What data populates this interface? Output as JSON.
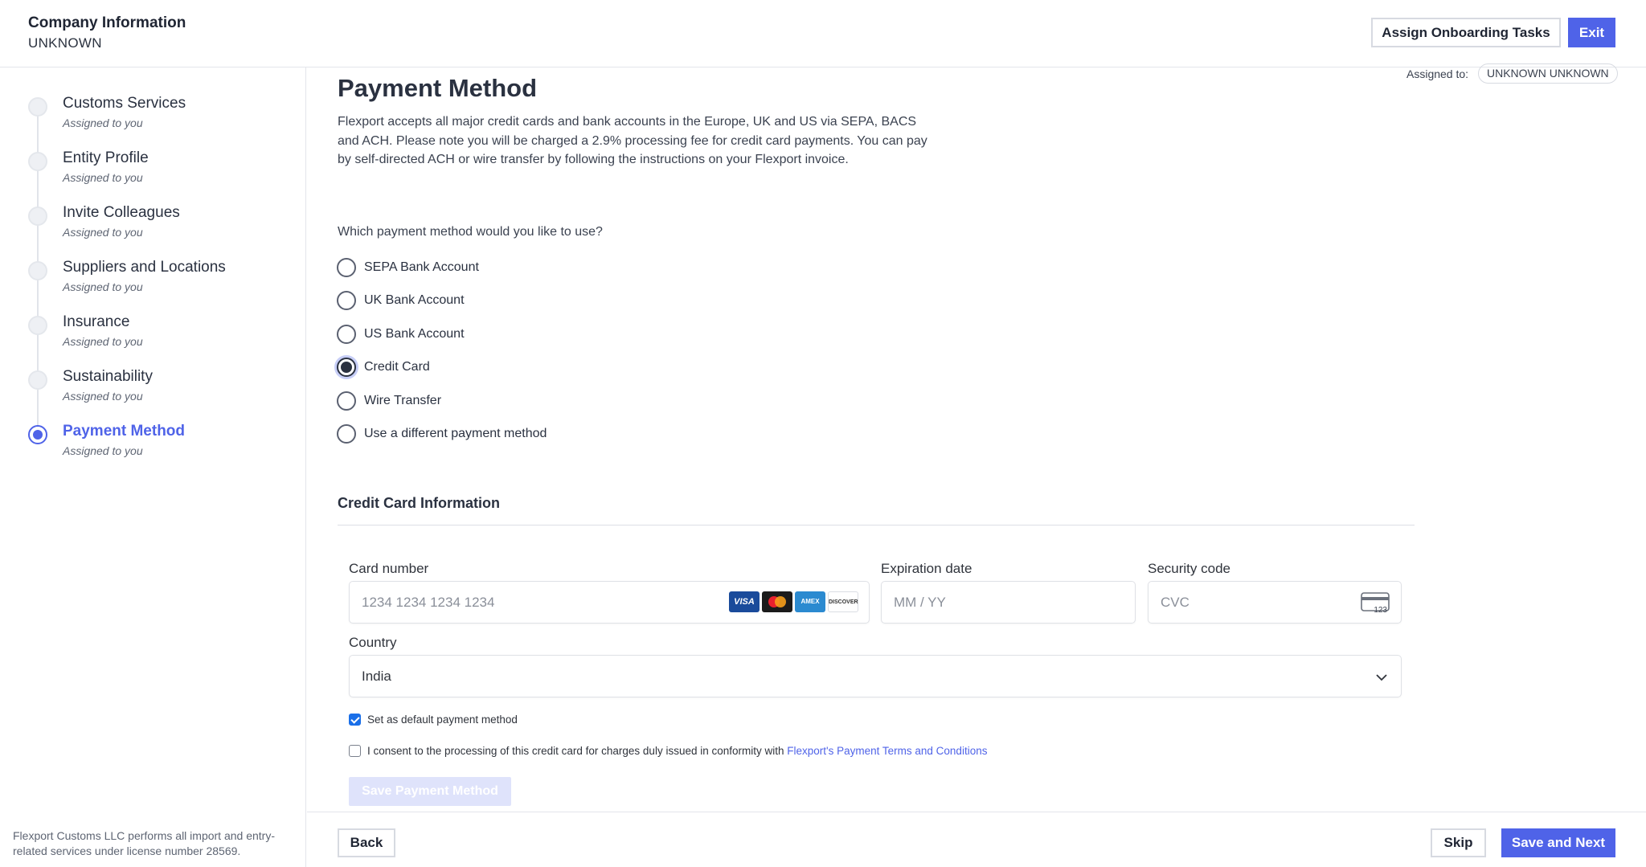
{
  "header": {
    "title": "Company Information",
    "company": "UNKNOWN",
    "assign_button": "Assign Onboarding Tasks",
    "exit_button": "Exit"
  },
  "sidebar": {
    "steps": [
      {
        "title": "Customs Services",
        "sub": "Assigned to you",
        "active": false
      },
      {
        "title": "Entity Profile",
        "sub": "Assigned to you",
        "active": false
      },
      {
        "title": "Invite Colleagues",
        "sub": "Assigned to you",
        "active": false
      },
      {
        "title": "Suppliers and Locations",
        "sub": "Assigned to you",
        "active": false
      },
      {
        "title": "Insurance",
        "sub": "Assigned to you",
        "active": false
      },
      {
        "title": "Sustainability",
        "sub": "Assigned to you",
        "active": false
      },
      {
        "title": "Payment Method",
        "sub": "Assigned to you",
        "active": true
      }
    ],
    "footer": "Flexport Customs LLC performs all import and entry-related services under license number 28569."
  },
  "main": {
    "assigned_label": "Assigned to:",
    "assigned_to": "UNKNOWN UNKNOWN",
    "title": "Payment Method",
    "intro": "Flexport accepts all major credit cards and bank accounts in the Europe, UK and US via SEPA, BACS and ACH. Please note you will be charged a 2.9% processing fee for credit card payments. You can pay by self-directed ACH or wire transfer by following the instructions on your Flexport invoice.",
    "question": "Which payment method would you like to use?",
    "options": [
      {
        "label": "SEPA Bank Account",
        "checked": false
      },
      {
        "label": "UK Bank Account",
        "checked": false
      },
      {
        "label": "US Bank Account",
        "checked": false
      },
      {
        "label": "Credit Card",
        "checked": true
      },
      {
        "label": "Wire Transfer",
        "checked": false
      },
      {
        "label": "Use a different payment method",
        "checked": false
      }
    ]
  },
  "credit_card": {
    "heading": "Credit Card Information",
    "card_number_label": "Card number",
    "card_number_placeholder": "1234 1234 1234 1234",
    "brands": [
      "VISA",
      "MC",
      "AMEX",
      "DISCOVER"
    ],
    "expiration_label": "Expiration date",
    "expiration_placeholder": "MM / YY",
    "security_label": "Security code",
    "security_placeholder": "CVC",
    "cvc_icon_text": "123",
    "country_label": "Country",
    "country_value": "India",
    "default_checkbox": {
      "label": "Set as default payment method",
      "checked": true
    },
    "consent_checkbox": {
      "label": "I consent to the processing of this credit card for charges duly issued in conformity with",
      "link": "Flexport's Payment Terms and Conditions",
      "checked": false
    },
    "save_button": "Save Payment Method"
  },
  "footer": {
    "back": "Back",
    "skip": "Skip",
    "next": "Save and Next"
  },
  "colors": {
    "accent": "#4f63e8",
    "checkbox_blue": "#1a6fe8"
  }
}
